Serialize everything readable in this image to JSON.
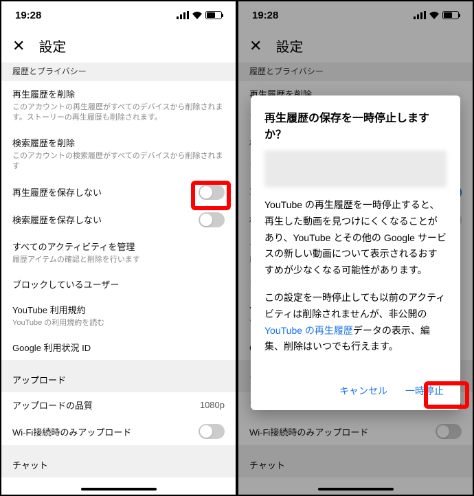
{
  "status": {
    "time": "19:28"
  },
  "header": {
    "title": "設定",
    "close_label": "✕"
  },
  "sections": {
    "privacy_heading": "履歴とプライバシー",
    "clear_watch": {
      "title": "再生履歴を削除",
      "desc": "このアカウントの再生履歴がすべてのデバイスから削除されます。ストーリーの再生履歴も削除されます。"
    },
    "clear_search": {
      "title": "検索履歴を削除",
      "desc": "このアカウントの検索履歴がすべてのデバイスから削除されます"
    },
    "pause_watch": {
      "title": "再生履歴を保存しない"
    },
    "pause_search": {
      "title": "検索履歴を保存しない"
    },
    "manage_activity": {
      "title": "すべてのアクティビティを管理",
      "desc": "履歴アイテムの確認と削除を行います"
    },
    "blocked_users": {
      "title": "ブロックしているユーザー"
    },
    "terms": {
      "title": "YouTube 利用規約",
      "desc": "YouTube の利用規約を読む"
    },
    "usage_id": {
      "title": "Google 利用状況 ID"
    },
    "upload_heading": "アップロード",
    "upload_quality": {
      "title": "アップロードの品質",
      "value": "1080p"
    },
    "wifi_upload": {
      "title": "Wi-Fi接続時のみアップロード"
    },
    "chat_heading": "チャット"
  },
  "dialog": {
    "title": "再生履歴の保存を一時停止しますか？",
    "body1": "YouTube の再生履歴を一時停止すると、再生した動画を見つけにくくなることがあり、YouTube とその他の Google サービスの新しい動画について表示されるおすすめが少なくなる可能性があります。",
    "body2_pre": "この設定を一時停止しても以前のアクティビティは削除されませんが、非公開の ",
    "body2_link": "YouTube の再生履歴",
    "body2_post": "データの表示、編集、削除はいつでも行えます。",
    "cancel": "キャンセル",
    "confirm": "一時停止"
  },
  "toggles": {
    "pause_watch_left": false,
    "pause_search_left": false,
    "wifi_upload_left": false,
    "pause_watch_right": true,
    "pause_search_right": false,
    "wifi_upload_right": false
  }
}
